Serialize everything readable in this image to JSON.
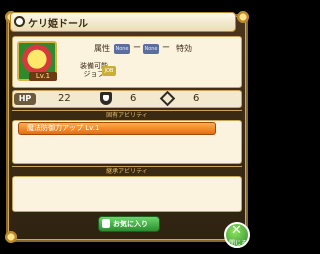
{
  "header": {
    "title": "ケリ姫ドール"
  },
  "portrait": {
    "level_label": "Lv.1"
  },
  "info": {
    "attribute_label": "属性",
    "attr1": "None",
    "attr2": "None",
    "dash": "ー",
    "special_label": "特効",
    "equip_job_label": "装備可能\nジョブ",
    "job_icon_text": "JOB"
  },
  "stats": {
    "hp_label": "HP",
    "hp": "22",
    "def": "6",
    "res": "6"
  },
  "unique_ability": {
    "header": "固有アビリティ",
    "rows": [
      "魔法防御力アップ Lv.1"
    ]
  },
  "inherit_ability": {
    "header": "継承アビリティ"
  },
  "footer": {
    "favorite_label": "お気に入り",
    "close_label": "閉じる"
  },
  "colors": {
    "accent": "#e56d12",
    "frame": "#8a6a2a",
    "button": "#2a8e2c"
  }
}
